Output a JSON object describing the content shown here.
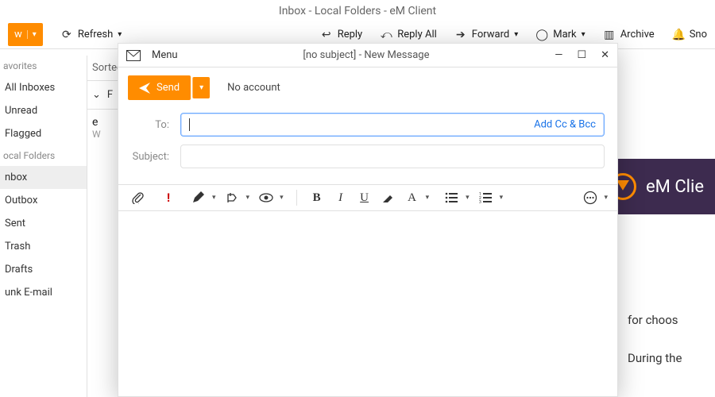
{
  "main": {
    "title": "Inbox - Local Folders - eM Client",
    "toolbar": {
      "new": "w",
      "refresh": "Refresh",
      "reply": "Reply",
      "reply_all": "Reply All",
      "forward": "Forward",
      "mark": "Mark",
      "archive": "Archive",
      "snooze": "Sno"
    },
    "sidebar": {
      "favorites_label": "avorites",
      "all_inboxes": "All Inboxes",
      "unread": "Unread",
      "flagged": "Flagged",
      "local_label": "ocal Folders",
      "inbox": "nbox",
      "outbox": "Outbox",
      "sent": "Sent",
      "trash": "Trash",
      "drafts": "Drafts",
      "junk": "unk E-mail"
    },
    "list": {
      "sorted": "Sorted",
      "group": "F",
      "from": "e",
      "preview": "W"
    },
    "banner_brand": "eM Clie",
    "preview_lines": [
      "for choos",
      "During the"
    ]
  },
  "compose": {
    "titlebar": {
      "menu": "Menu",
      "title": "[no subject] - New Message"
    },
    "actionbar": {
      "send": "Send",
      "no_account": "No account"
    },
    "fields": {
      "to_label": "To:",
      "subject_label": "Subject:",
      "add_cc": "Add Cc & Bcc"
    }
  }
}
